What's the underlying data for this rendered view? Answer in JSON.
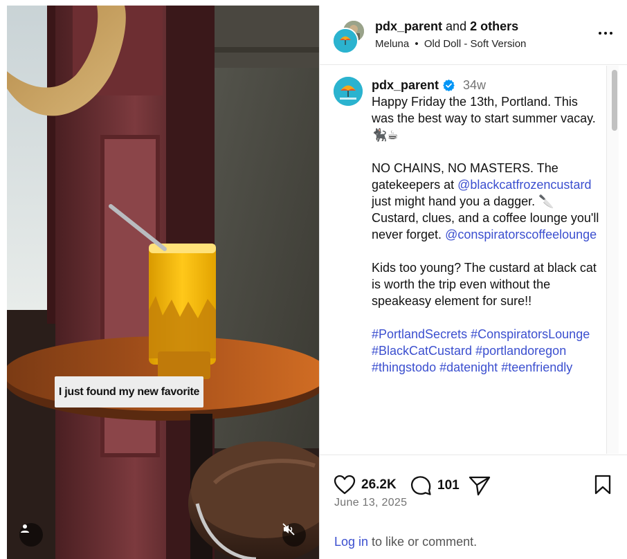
{
  "media": {
    "overlay_text": "I just found my new favorite",
    "user_icon": "user-icon",
    "mute_icon": "speaker-muted-icon"
  },
  "header": {
    "username": "pdx_parent",
    "and_text": "and",
    "others": "2 others",
    "artist": "Meluna",
    "separator": "•",
    "song": "Old Doll - Soft Version"
  },
  "post": {
    "username": "pdx_parent",
    "time_ago": "34w",
    "lines": [
      [
        {
          "t": "Happy Friday the 13th, Portland. This was the best way to start summer vacay. 🐈‍⬛☕"
        }
      ],
      [
        {
          "t": "NO CHAINS, NO MASTERS. The gatekeepers at "
        },
        {
          "t": "@blackcatfrozencustard",
          "link": true
        },
        {
          "t": " just might hand you a dagger. 🔪 Custard, clues, and a coffee lounge you'll never forget. "
        },
        {
          "t": "@conspiratorscoffeelounge",
          "link": true
        }
      ],
      [
        {
          "t": "Kids too young? The custard at black cat is worth the trip even without the speakeasy element for sure!!"
        }
      ],
      [
        {
          "t": "#PortlandSecrets",
          "link": true
        },
        {
          "t": " "
        },
        {
          "t": "#ConspiratorsLounge",
          "link": true
        },
        {
          "t": " "
        },
        {
          "t": "#BlackCatCustard",
          "link": true
        },
        {
          "t": " "
        },
        {
          "t": "#portlandoregon",
          "link": true
        },
        {
          "t": " "
        },
        {
          "t": "#thingstodo",
          "link": true
        },
        {
          "t": " "
        },
        {
          "t": "#datenight",
          "link": true
        },
        {
          "t": " "
        },
        {
          "t": "#teenfriendly",
          "link": true
        }
      ]
    ]
  },
  "actions": {
    "likes": "26.2K",
    "comments": "101",
    "date": "June 13, 2025",
    "login_link": "Log in",
    "login_rest": " to like or comment."
  },
  "colors": {
    "link": "#3b4fcf",
    "verified": "#0095f6",
    "secondary_text": "#737373"
  }
}
